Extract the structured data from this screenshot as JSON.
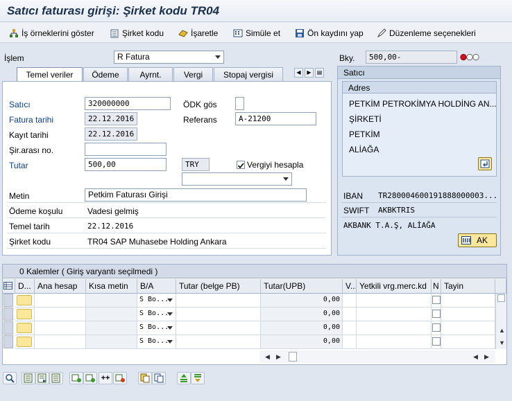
{
  "title": "Satıcı faturası girişi: Şirket kodu TR04",
  "toolbar": [
    {
      "label": "İş örneklerini göster",
      "icon": "tree-icon"
    },
    {
      "label": "Şirket kodu",
      "icon": "company-icon"
    },
    {
      "label": "İşaretle",
      "icon": "hold-icon"
    },
    {
      "label": "Simüle et",
      "icon": "simulate-icon"
    },
    {
      "label": "Ön kaydını yap",
      "icon": "save-icon"
    },
    {
      "label": "Düzenleme seçenekleri",
      "icon": "edit-options-icon"
    }
  ],
  "transaction": {
    "label": "İşlem",
    "value": "R Fatura"
  },
  "balance": {
    "label": "Bky.",
    "value": "500,00-",
    "status_color": "#d0101a"
  },
  "tabs": [
    "Temel veriler",
    "Ödeme",
    "Ayrnt.",
    "Vergi",
    "Stopaj vergisi"
  ],
  "basic": {
    "vendor_label": "Satıcı",
    "vendor_value": "320000000",
    "invoice_date_label": "Fatura tarihi",
    "invoice_date_value": "22.12.2016",
    "posting_date_label": "Kayıt tarihi",
    "posting_date_value": "22.12.2016",
    "cross_cc_label": "Şir.arası no.",
    "cross_cc_value": "",
    "amount_label": "Tutar",
    "amount_value": "500,00",
    "currency_value": "TRY",
    "calc_tax_label": "Vergiyi hesapla",
    "calc_tax_checked": true,
    "odk_label": "ÖDK gös",
    "reference_label": "Referans",
    "reference_value": "A-21200",
    "text_label": "Metin",
    "text_value": "Petkim Faturası Girişi",
    "payment_terms_label": "Ödeme koşulu",
    "payment_terms_value": "Vadesi gelmiş",
    "baseline_label": "Temel tarih",
    "baseline_value": "22.12.2016",
    "company_label": "Şirket kodu",
    "company_value": "TR04 SAP Muhasebe Holding Ankara"
  },
  "vendor_panel": {
    "title": "Satıcı",
    "address_title": "Adres",
    "address_lines": [
      "PETKİM PETROKİMYA HOLDİNG AN...",
      "ŞİRKETİ",
      "PETKİM",
      "ALİAĞA"
    ],
    "iban_label": "IBAN",
    "iban_value": "TR280004600191888000003...",
    "swift_label": "SWIFT",
    "swift_value": "AKBKTRIS",
    "bank_value": "AKBANK T.A.Ş, ALİAĞA",
    "ak_label": "AK"
  },
  "items": {
    "title": "0 Kalemler ( Giriş varyantı seçilmedi )",
    "columns": [
      "D...",
      "Ana hesap",
      "Kısa metin",
      "B/A",
      "Tutar (belge PB)",
      "Tutar(UPB)",
      "V...",
      "Yetkili vrg.merc.kd",
      "N",
      "Tayin"
    ],
    "rows": [
      {
        "ba": "S Bo...",
        "amount_upb": "0,00"
      },
      {
        "ba": "S Bo...",
        "amount_upb": "0,00"
      },
      {
        "ba": "S Bo...",
        "amount_upb": "0,00"
      },
      {
        "ba": "S Bo...",
        "amount_upb": "0,00"
      }
    ]
  }
}
